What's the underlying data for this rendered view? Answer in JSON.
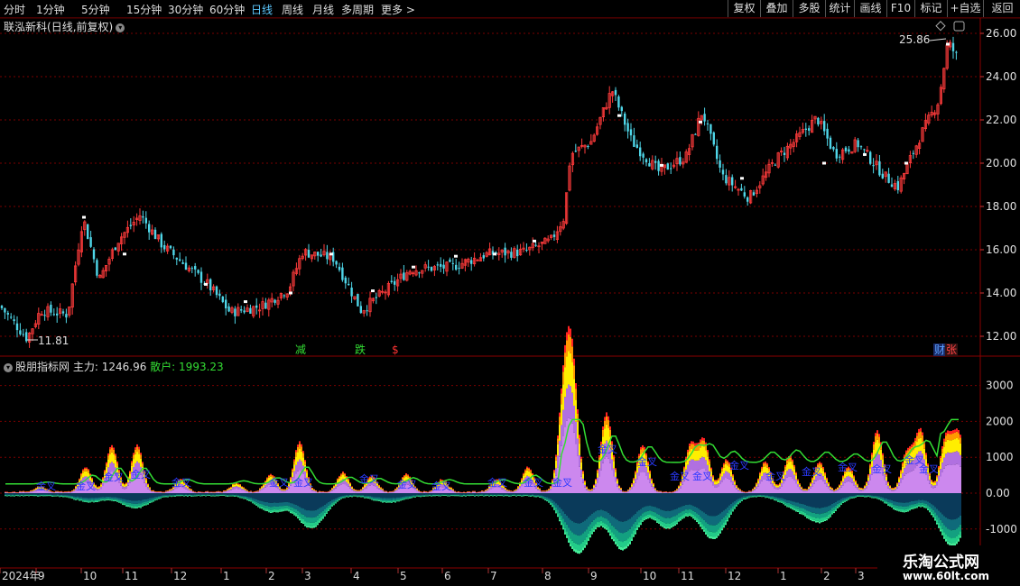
{
  "toolbar": {
    "periods": [
      "分时",
      "1分钟",
      "5分钟",
      "15分钟",
      "30分钟",
      "60分钟",
      "日线",
      "周线",
      "月线",
      "多周期",
      "更多 >"
    ],
    "active_period": "日线",
    "right_buttons": [
      "复权",
      "叠加",
      "多股",
      "统计",
      "画线",
      "F10",
      "标记",
      "+自选",
      "返回"
    ]
  },
  "main_chart": {
    "stock_name": "联泓新科",
    "mode": "(日线,前复权)",
    "price_axis": [
      "26.00",
      "24.00",
      "22.00",
      "20.00",
      "18.00",
      "16.00",
      "14.00",
      "12.00"
    ],
    "high_label": "25.86",
    "low_label": "11.81",
    "markers": [
      {
        "text": "减",
        "color": "#33dd33"
      },
      {
        "text": "跌",
        "color": "#33dd33"
      },
      {
        "text": "$",
        "color": "#ff3333"
      },
      {
        "text": "财",
        "color": "#5aa0ff"
      },
      {
        "text": "张",
        "color": "#ff4444"
      }
    ]
  },
  "indicator": {
    "name": "股朋指标网",
    "main_label": "主力:",
    "main_value": "1246.96",
    "retail_label": "散户:",
    "retail_value": "1993.23",
    "axis": [
      "3000",
      "2000",
      "1000",
      "0.00",
      "-1000"
    ],
    "cross_label": "金叉"
  },
  "timeline": {
    "labels": [
      "2024年",
      "9",
      "10",
      "11",
      "12",
      "1",
      "2",
      "3",
      "4",
      "5",
      "6",
      "7",
      "8",
      "9",
      "10",
      "11",
      "12",
      "1",
      "2",
      "3"
    ]
  },
  "watermark": {
    "line1": "乐淘公式网",
    "line2": "www.60lt.com"
  },
  "colors": {
    "up": "#ff3b3b",
    "down": "#4fd6e8",
    "grid": "#7a0000",
    "retail": "#33dd33"
  }
}
